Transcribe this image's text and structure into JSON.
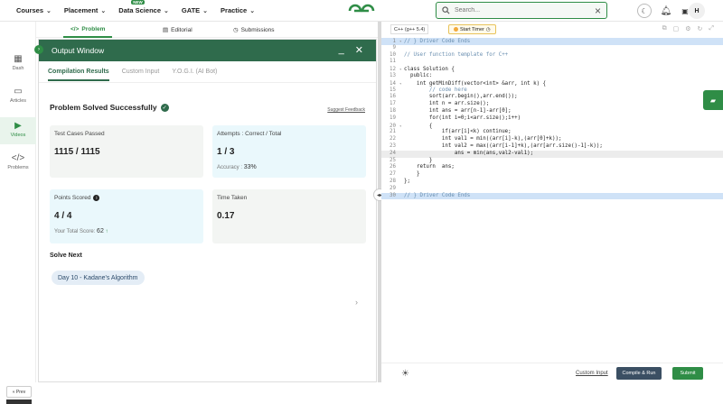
{
  "nav": {
    "items": [
      {
        "label": "Courses"
      },
      {
        "label": "Placement"
      },
      {
        "label": "Data Science",
        "badge": "NEW"
      },
      {
        "label": "GATE"
      },
      {
        "label": "Practice"
      }
    ]
  },
  "search": {
    "placeholder": "Search..."
  },
  "user": {
    "initial": "H"
  },
  "sidebar": {
    "items": [
      {
        "label": "Dash"
      },
      {
        "label": "Articles"
      },
      {
        "label": "Videos"
      },
      {
        "label": "Problems"
      }
    ],
    "prev_label": "« Prev"
  },
  "problem_tabs": {
    "problem": "Problem",
    "editorial": "Editorial",
    "submissions": "Submissions"
  },
  "output_window": {
    "title": "Output Window",
    "tabs": [
      "Compilation Results",
      "Custom Input",
      "Y.O.G.I. (AI Bot)"
    ],
    "status": "Problem Solved Successfully",
    "feedback": "Suggest Feedback",
    "cards": {
      "tests_label": "Test Cases Passed",
      "tests_value": "1115 / 1115",
      "attempts_label": "Attempts : Correct / Total",
      "attempts_value": "1 / 3",
      "accuracy_label": "Accuracy :",
      "accuracy_value": "33%",
      "points_label": "Points Scored",
      "points_value": "4 / 4",
      "total_label": "Your Total Score:",
      "total_value": "62",
      "time_label": "Time Taken",
      "time_value": "0.17"
    },
    "solve_next_label": "Solve Next",
    "next_problem": "Day 10 - Kadane's Algorithm"
  },
  "editor": {
    "language": "C++ (g++ 5.4)",
    "timer_label": "Start Timer",
    "lines": [
      {
        "n": "1",
        "text": "// } Driver Code Ends",
        "cls": "hl"
      },
      {
        "n": "9",
        "text": "",
        "cls": ""
      },
      {
        "n": "10",
        "text": "// User function template for C++",
        "cls": ""
      },
      {
        "n": "11",
        "text": "",
        "cls": ""
      },
      {
        "n": "12",
        "text": "class Solution {",
        "cls": ""
      },
      {
        "n": "13",
        "text": "  public:",
        "cls": ""
      },
      {
        "n": "14",
        "text": "    int getMinDiff(vector<int> &arr, int k) {",
        "cls": ""
      },
      {
        "n": "15",
        "text": "        // code here",
        "cls": ""
      },
      {
        "n": "16",
        "text": "        sort(arr.begin(),arr.end());",
        "cls": ""
      },
      {
        "n": "17",
        "text": "        int n = arr.size();",
        "cls": ""
      },
      {
        "n": "18",
        "text": "        int ans = arr[n-1]-arr[0];",
        "cls": ""
      },
      {
        "n": "19",
        "text": "        for(int i=0;i<arr.size();i++)",
        "cls": ""
      },
      {
        "n": "20",
        "text": "        {",
        "cls": ""
      },
      {
        "n": "21",
        "text": "            if(arr[i]<k) continue;",
        "cls": ""
      },
      {
        "n": "22",
        "text": "            int val1 = min((arr[i]-k),(arr[0]+k));",
        "cls": ""
      },
      {
        "n": "23",
        "text": "            int val2 = max((arr[i-1]+k),(arr[arr.size()-1]-k));",
        "cls": ""
      },
      {
        "n": "24",
        "text": "                ans = min(ans,val2-val1);",
        "cls": "cur"
      },
      {
        "n": "25",
        "text": "        }",
        "cls": ""
      },
      {
        "n": "26",
        "text": "    return  ans;",
        "cls": ""
      },
      {
        "n": "27",
        "text": "    }",
        "cls": ""
      },
      {
        "n": "28",
        "text": "};",
        "cls": ""
      },
      {
        "n": "29",
        "text": "",
        "cls": ""
      },
      {
        "n": "30",
        "text": "// } Driver Code Ends",
        "cls": "hl"
      }
    ],
    "custom_input": "Custom Input",
    "compile_run": "Compile & Run",
    "submit": "Submit"
  }
}
